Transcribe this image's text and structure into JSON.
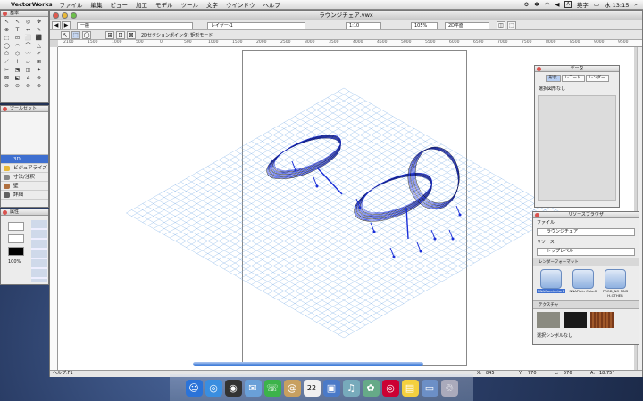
{
  "menubar": {
    "app": "VectorWorks",
    "items": [
      "ファイル",
      "編集",
      "ビュー",
      "加工",
      "モデル",
      "ツール",
      "文字",
      "ウインドウ",
      "ヘルプ"
    ],
    "input_mode": "A",
    "input_label": "英字",
    "clock": "水 13:15"
  },
  "document": {
    "title": "ラウンジチェア.vwx"
  },
  "toolbar1": {
    "class_field": "一般",
    "layer_field": "レイヤー-1",
    "scale_field": "1:10",
    "zoom_field": "105%",
    "view_field": "2D平面"
  },
  "toolbar2": {
    "mode_label": "2Dセクションポインタ: 矩形モード"
  },
  "ruler": {
    "ticks": [
      "2100",
      "1500",
      "1000",
      "500",
      "0",
      "500",
      "1000",
      "1500",
      "2000",
      "2500",
      "3000",
      "3500",
      "4000",
      "4500",
      "5000",
      "5500",
      "6000",
      "6500",
      "7000",
      "7500",
      "8000",
      "8500",
      "9000",
      "9500"
    ]
  },
  "status": {
    "help": "ヘルプ:F1",
    "x_label": "X:",
    "x_value": "845",
    "y_label": "Y:",
    "y_value": "770",
    "l_label": "L:",
    "l_value": "576",
    "a_label": "A:",
    "a_value": "18.75°"
  },
  "tool_palette": {
    "title": "基本",
    "glyphs": [
      "↖",
      "↖",
      "◎",
      "✥",
      "⊕",
      "T",
      "↔",
      "✎",
      "⬚",
      "⊡",
      "⬜",
      "⬛",
      "◯",
      "◠",
      "⌒",
      "△",
      "⬠",
      "⬡",
      "〰",
      "✐",
      "⟋",
      "⌇",
      "▱",
      "⊞",
      "✂",
      "⬔",
      "◫",
      "✦",
      "⊠",
      "⬕",
      "⌂",
      "⊗",
      "⊘",
      "⊙",
      "⊚",
      "⊛"
    ]
  },
  "tool_sets": {
    "title": "ツールセット",
    "items": [
      {
        "label": "3D",
        "color": "#3e6fd0"
      },
      {
        "label": "ビジュアライズ",
        "color": "#e8b838"
      },
      {
        "label": "寸法/注釈",
        "color": "#888888"
      },
      {
        "label": "壁",
        "color": "#b07040"
      },
      {
        "label": "詳細",
        "color": "#606060"
      }
    ]
  },
  "attributes": {
    "title": "属性",
    "zoom": "100%"
  },
  "data_palette": {
    "title": "データ",
    "tabs": [
      "形状",
      "レコード",
      "レンダー"
    ],
    "selection": "選択図形なし"
  },
  "resource_browser": {
    "title": "リソースブラウザ",
    "file_label": "ファイル",
    "file_value": "ラウンジチェア",
    "resource_label": "リソース",
    "resource_value": "トップレベル",
    "section1": "レンダーフォーマット",
    "resources": [
      "NNAConductor2",
      "NNAPlain Color2",
      "PROD_NO FINS H-OTHER"
    ],
    "section2": "テクスチャ",
    "footer": "選択シンボルなし"
  },
  "colors": {
    "wire": "#1a2fd8",
    "grid": "#7fb0e6",
    "select": "#3e6fd0"
  },
  "dock": {
    "icons": [
      "finder-icon",
      "safari-icon",
      "dashboard-icon",
      "mail-icon",
      "ichat-icon",
      "addressbook-icon",
      "ical-icon",
      "preview-icon",
      "itunes-icon",
      "iphoto-icon",
      "vectorworks-icon",
      "stickies-icon",
      "folder-icon",
      "trash-icon"
    ]
  }
}
